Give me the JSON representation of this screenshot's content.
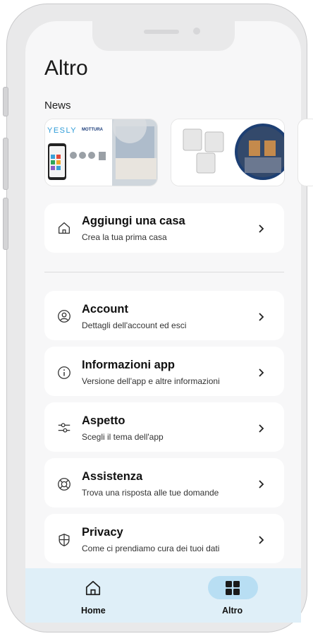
{
  "page": {
    "title": "Altro",
    "news_label": "News"
  },
  "news": [
    {
      "name": "news-card-yesly",
      "brand_left": "YESLY",
      "brand_right": "MOTTURA"
    },
    {
      "name": "news-card-modules"
    }
  ],
  "menu": [
    {
      "id": "add-home",
      "title": "Aggiungi una casa",
      "subtitle": "Crea la tua prima casa",
      "icon": "home-icon"
    },
    {
      "id": "account",
      "title": "Account",
      "subtitle": "Dettagli dell'account ed esci",
      "icon": "user-circle-icon"
    },
    {
      "id": "app-info",
      "title": "Informazioni app",
      "subtitle": "Versione dell'app e altre informazioni",
      "icon": "info-icon"
    },
    {
      "id": "appearance",
      "title": "Aspetto",
      "subtitle": "Scegli il tema dell'app",
      "icon": "sliders-icon"
    },
    {
      "id": "support",
      "title": "Assistenza",
      "subtitle": "Trova una risposta alle tue domande",
      "icon": "lifebuoy-icon"
    },
    {
      "id": "privacy",
      "title": "Privacy",
      "subtitle": "Come ci prendiamo cura dei tuoi dati",
      "icon": "shield-icon"
    }
  ],
  "tabs": [
    {
      "label": "Home",
      "icon": "home-icon",
      "selected": false
    },
    {
      "label": "Altro",
      "icon": "grid-icon",
      "selected": true
    }
  ],
  "colors": {
    "tabbar": "#dfeff8",
    "tab_selected_pill": "#b8def3",
    "card": "#ffffff",
    "background": "#f7f7f8"
  }
}
